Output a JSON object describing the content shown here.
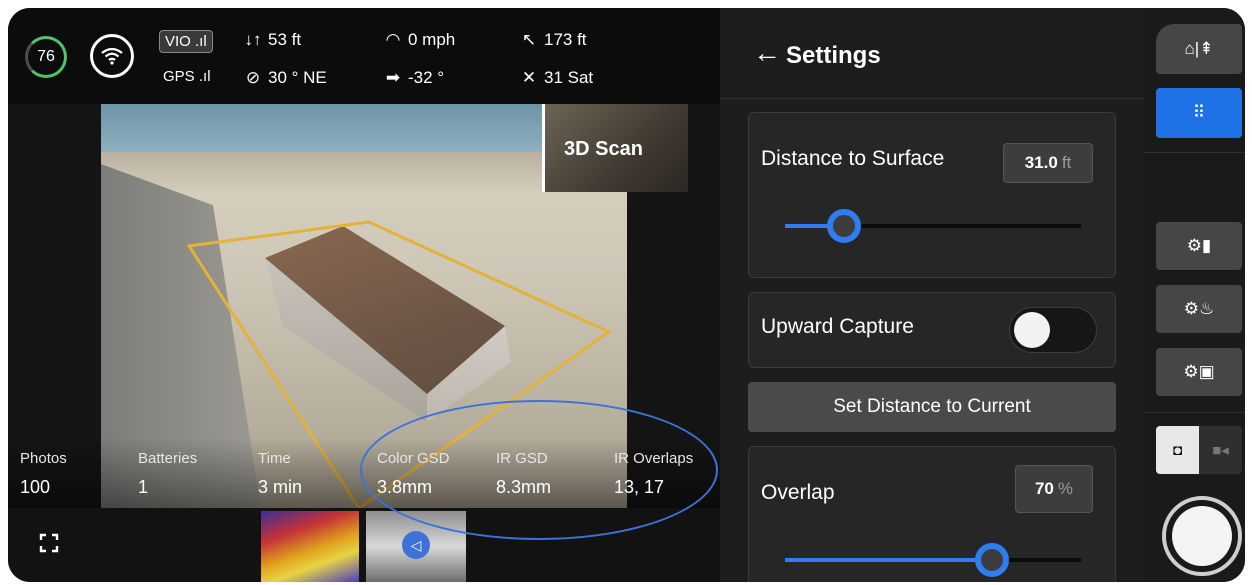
{
  "status": {
    "battery_pct": "76",
    "vio_label": "VIO",
    "gps_label": "GPS",
    "altitude": "53 ft",
    "speed": "0 mph",
    "distance": "173 ft",
    "heading": "30 ° NE",
    "gimbal": "-32 °",
    "satellites": "31 Sat"
  },
  "camera": {
    "scan_label": "3D Scan"
  },
  "stats": [
    {
      "label": "Photos",
      "value": "100"
    },
    {
      "label": "Batteries",
      "value": "1"
    },
    {
      "label": "Time",
      "value": "3 min"
    },
    {
      "label": "Color GSD",
      "value": "3.8mm"
    },
    {
      "label": "IR GSD",
      "value": "8.3mm"
    },
    {
      "label": "IR Overlaps",
      "value": "13, 17"
    }
  ],
  "settings": {
    "title": "Settings",
    "distance_label": "Distance to Surface",
    "distance_value": "31.0",
    "distance_unit": "ft",
    "distance_slider_fraction": 0.2,
    "upward_label": "Upward Capture",
    "upward_on": false,
    "set_distance_label": "Set Distance to Current",
    "overlap_label": "Overlap",
    "overlap_value": "70",
    "overlap_unit": "%",
    "overlap_slider_fraction": 0.7
  },
  "rail": {
    "accent": "#1e72e6",
    "mode": "photo"
  },
  "icons": [
    "battery-ring-icon",
    "wifi-icon",
    "altitude-icon",
    "speedometer-icon",
    "distance-icon",
    "compass-icon",
    "gimbal-icon",
    "satellite-icon",
    "back-arrow-icon",
    "expand-icon",
    "home-return-icon",
    "grid-icon",
    "settings-map-icon",
    "settings-fire-icon",
    "settings-camera-icon",
    "camera-icon",
    "video-icon",
    "shutter-icon"
  ]
}
